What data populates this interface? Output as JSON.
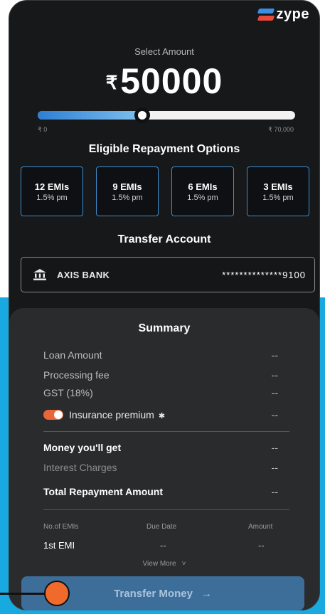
{
  "brand": {
    "name": "zype"
  },
  "select_amount": {
    "label": "Select Amount",
    "currency": "₹",
    "value": "50000",
    "slider_fraction": 0.405,
    "min_label": "₹ 0",
    "max_label": "₹ 70,000"
  },
  "repayment": {
    "title": "Eligible Repayment Options",
    "options": [
      {
        "label": "12 EMIs",
        "rate": "1.5% pm"
      },
      {
        "label": "9 EMIs",
        "rate": "1.5% pm"
      },
      {
        "label": "6 EMIs",
        "rate": "1.5% pm"
      },
      {
        "label": "3 EMIs",
        "rate": "1.5% pm"
      }
    ]
  },
  "transfer": {
    "title": "Transfer Account",
    "bank_name": "AXIS BANK",
    "account": "**************9100",
    "bank_icon": "bank-icon"
  },
  "summary": {
    "title": "Summary",
    "rows": {
      "loan_amount": {
        "label": "Loan Amount",
        "value": "--"
      },
      "processing_fee": {
        "label": "Processing fee",
        "value": "--"
      },
      "gst": {
        "label": "GST (18%)",
        "value": "--"
      },
      "insurance": {
        "label": "Insurance premium",
        "value": "--",
        "info": "✱"
      },
      "money_you_get": {
        "label": "Money you'll get",
        "value": "--"
      },
      "interest": {
        "label": "Interest Charges",
        "value": "--"
      },
      "total": {
        "label": "Total Repayment Amount",
        "value": "--"
      }
    },
    "table": {
      "headers": [
        "No.of EMIs",
        "Due Date",
        "Amount"
      ],
      "first_row": [
        "1st EMI",
        "--",
        "--"
      ]
    },
    "view_more": "View More",
    "chevron": "˅"
  },
  "cta": {
    "label": "Transfer Money",
    "arrow": "→"
  },
  "colors": {
    "accent": "#3d8fd0",
    "button": "#3d6e9a",
    "toggle": "#e8663a",
    "background_cyan": "#18a9e0"
  }
}
